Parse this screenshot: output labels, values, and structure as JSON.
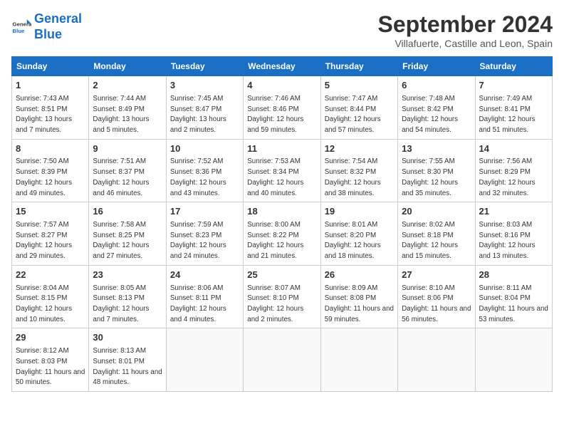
{
  "logo": {
    "line1": "General",
    "line2": "Blue"
  },
  "title": "September 2024",
  "location": "Villafuerte, Castille and Leon, Spain",
  "weekdays": [
    "Sunday",
    "Monday",
    "Tuesday",
    "Wednesday",
    "Thursday",
    "Friday",
    "Saturday"
  ],
  "weeks": [
    [
      {
        "day": "1",
        "sunrise": "Sunrise: 7:43 AM",
        "sunset": "Sunset: 8:51 PM",
        "daylight": "Daylight: 13 hours and 7 minutes."
      },
      {
        "day": "2",
        "sunrise": "Sunrise: 7:44 AM",
        "sunset": "Sunset: 8:49 PM",
        "daylight": "Daylight: 13 hours and 5 minutes."
      },
      {
        "day": "3",
        "sunrise": "Sunrise: 7:45 AM",
        "sunset": "Sunset: 8:47 PM",
        "daylight": "Daylight: 13 hours and 2 minutes."
      },
      {
        "day": "4",
        "sunrise": "Sunrise: 7:46 AM",
        "sunset": "Sunset: 8:46 PM",
        "daylight": "Daylight: 12 hours and 59 minutes."
      },
      {
        "day": "5",
        "sunrise": "Sunrise: 7:47 AM",
        "sunset": "Sunset: 8:44 PM",
        "daylight": "Daylight: 12 hours and 57 minutes."
      },
      {
        "day": "6",
        "sunrise": "Sunrise: 7:48 AM",
        "sunset": "Sunset: 8:42 PM",
        "daylight": "Daylight: 12 hours and 54 minutes."
      },
      {
        "day": "7",
        "sunrise": "Sunrise: 7:49 AM",
        "sunset": "Sunset: 8:41 PM",
        "daylight": "Daylight: 12 hours and 51 minutes."
      }
    ],
    [
      {
        "day": "8",
        "sunrise": "Sunrise: 7:50 AM",
        "sunset": "Sunset: 8:39 PM",
        "daylight": "Daylight: 12 hours and 49 minutes."
      },
      {
        "day": "9",
        "sunrise": "Sunrise: 7:51 AM",
        "sunset": "Sunset: 8:37 PM",
        "daylight": "Daylight: 12 hours and 46 minutes."
      },
      {
        "day": "10",
        "sunrise": "Sunrise: 7:52 AM",
        "sunset": "Sunset: 8:36 PM",
        "daylight": "Daylight: 12 hours and 43 minutes."
      },
      {
        "day": "11",
        "sunrise": "Sunrise: 7:53 AM",
        "sunset": "Sunset: 8:34 PM",
        "daylight": "Daylight: 12 hours and 40 minutes."
      },
      {
        "day": "12",
        "sunrise": "Sunrise: 7:54 AM",
        "sunset": "Sunset: 8:32 PM",
        "daylight": "Daylight: 12 hours and 38 minutes."
      },
      {
        "day": "13",
        "sunrise": "Sunrise: 7:55 AM",
        "sunset": "Sunset: 8:30 PM",
        "daylight": "Daylight: 12 hours and 35 minutes."
      },
      {
        "day": "14",
        "sunrise": "Sunrise: 7:56 AM",
        "sunset": "Sunset: 8:29 PM",
        "daylight": "Daylight: 12 hours and 32 minutes."
      }
    ],
    [
      {
        "day": "15",
        "sunrise": "Sunrise: 7:57 AM",
        "sunset": "Sunset: 8:27 PM",
        "daylight": "Daylight: 12 hours and 29 minutes."
      },
      {
        "day": "16",
        "sunrise": "Sunrise: 7:58 AM",
        "sunset": "Sunset: 8:25 PM",
        "daylight": "Daylight: 12 hours and 27 minutes."
      },
      {
        "day": "17",
        "sunrise": "Sunrise: 7:59 AM",
        "sunset": "Sunset: 8:23 PM",
        "daylight": "Daylight: 12 hours and 24 minutes."
      },
      {
        "day": "18",
        "sunrise": "Sunrise: 8:00 AM",
        "sunset": "Sunset: 8:22 PM",
        "daylight": "Daylight: 12 hours and 21 minutes."
      },
      {
        "day": "19",
        "sunrise": "Sunrise: 8:01 AM",
        "sunset": "Sunset: 8:20 PM",
        "daylight": "Daylight: 12 hours and 18 minutes."
      },
      {
        "day": "20",
        "sunrise": "Sunrise: 8:02 AM",
        "sunset": "Sunset: 8:18 PM",
        "daylight": "Daylight: 12 hours and 15 minutes."
      },
      {
        "day": "21",
        "sunrise": "Sunrise: 8:03 AM",
        "sunset": "Sunset: 8:16 PM",
        "daylight": "Daylight: 12 hours and 13 minutes."
      }
    ],
    [
      {
        "day": "22",
        "sunrise": "Sunrise: 8:04 AM",
        "sunset": "Sunset: 8:15 PM",
        "daylight": "Daylight: 12 hours and 10 minutes."
      },
      {
        "day": "23",
        "sunrise": "Sunrise: 8:05 AM",
        "sunset": "Sunset: 8:13 PM",
        "daylight": "Daylight: 12 hours and 7 minutes."
      },
      {
        "day": "24",
        "sunrise": "Sunrise: 8:06 AM",
        "sunset": "Sunset: 8:11 PM",
        "daylight": "Daylight: 12 hours and 4 minutes."
      },
      {
        "day": "25",
        "sunrise": "Sunrise: 8:07 AM",
        "sunset": "Sunset: 8:10 PM",
        "daylight": "Daylight: 12 hours and 2 minutes."
      },
      {
        "day": "26",
        "sunrise": "Sunrise: 8:09 AM",
        "sunset": "Sunset: 8:08 PM",
        "daylight": "Daylight: 11 hours and 59 minutes."
      },
      {
        "day": "27",
        "sunrise": "Sunrise: 8:10 AM",
        "sunset": "Sunset: 8:06 PM",
        "daylight": "Daylight: 11 hours and 56 minutes."
      },
      {
        "day": "28",
        "sunrise": "Sunrise: 8:11 AM",
        "sunset": "Sunset: 8:04 PM",
        "daylight": "Daylight: 11 hours and 53 minutes."
      }
    ],
    [
      {
        "day": "29",
        "sunrise": "Sunrise: 8:12 AM",
        "sunset": "Sunset: 8:03 PM",
        "daylight": "Daylight: 11 hours and 50 minutes."
      },
      {
        "day": "30",
        "sunrise": "Sunrise: 8:13 AM",
        "sunset": "Sunset: 8:01 PM",
        "daylight": "Daylight: 11 hours and 48 minutes."
      },
      null,
      null,
      null,
      null,
      null
    ]
  ]
}
